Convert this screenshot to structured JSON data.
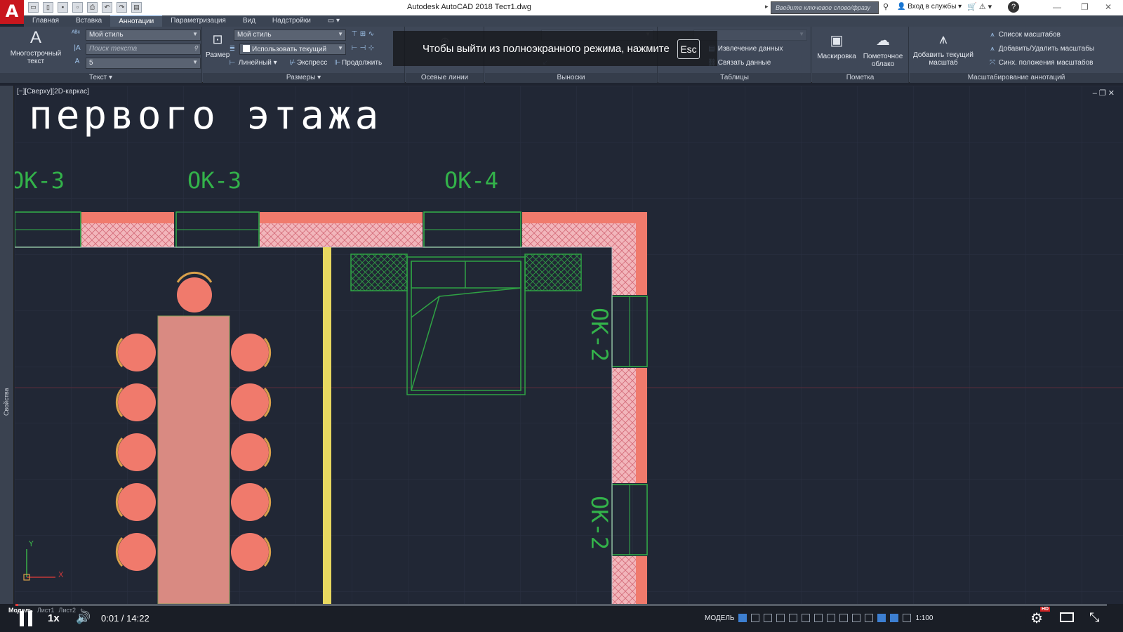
{
  "app": {
    "logo_letter": "A",
    "window_title": "Autodesk AutoCAD 2018    Тест1.dwg",
    "search_placeholder": "Введите ключевое слово/фразу",
    "sign_in": "Вход в службы",
    "help": "?"
  },
  "ribbon_tabs": [
    "Главная",
    "Вставка",
    "Аннотации",
    "Параметризация",
    "Вид",
    "Надстройки"
  ],
  "ribbon_active_tab": "Аннотации",
  "panels": {
    "text": {
      "title": "Текст",
      "mtext_label": "Многострочный текст",
      "style_value": "Мой стиль",
      "find_placeholder": "Поиск текста",
      "height_value": "5"
    },
    "dimensions": {
      "title": "Размеры",
      "dim_button": "Размер",
      "style_value": "Мой стиль",
      "layer_value": "Использовать текущий",
      "linear_label": "Линейный",
      "quick_label": "Экспресс",
      "continue_label": "Продолжить"
    },
    "centerlines": {
      "title": "Осевые линии"
    },
    "leaders": {
      "title": "Выноски"
    },
    "tables": {
      "title": "Таблицы",
      "extract_label": "Извлечение данных",
      "link_label": "Связать данные"
    },
    "markup": {
      "title": "Пометка",
      "mask_label": "Маскировка",
      "cloud_label": "Пометочное облако"
    },
    "annotation_scaling": {
      "title": "Масштабирование аннотаций",
      "add_scale_label": "Добавить текущий масштаб",
      "scale_list": "Список масштабов",
      "add_remove": "Добавить/Удалить масштабы",
      "sync": "Синх. положения масштабов"
    }
  },
  "fullscreen_notice": {
    "message": "Чтобы выйти из полноэкранного режима, нажмите",
    "key": "Esc"
  },
  "side_panel_label": "Свойства",
  "drawing": {
    "viewport_label": "[−][Сверху][2D-каркас]",
    "viewport_controls": "–  ❐  ✕",
    "heading": "первого этажа",
    "window_labels": [
      "ОК-3",
      "ОК-3",
      "ОК-4",
      "ОК-2",
      "ОК-2"
    ],
    "ucs_x": "X",
    "ucs_y": "Y",
    "colors": {
      "background": "#212735",
      "wall": "#f07a6c",
      "hatch": "#f0b4b8",
      "furniture": "#f07a6c",
      "window_green": "#33b24a",
      "partition": "#e8d860"
    }
  },
  "layout_tabs": [
    "Модель",
    "Лист1",
    "Лист2"
  ],
  "status": {
    "model": "МОДЕЛЬ",
    "scale": "1:100"
  },
  "video": {
    "speed": "1x",
    "time": "0:01 / 14:22",
    "progress": 0.0012,
    "hd_badge": "HD"
  }
}
